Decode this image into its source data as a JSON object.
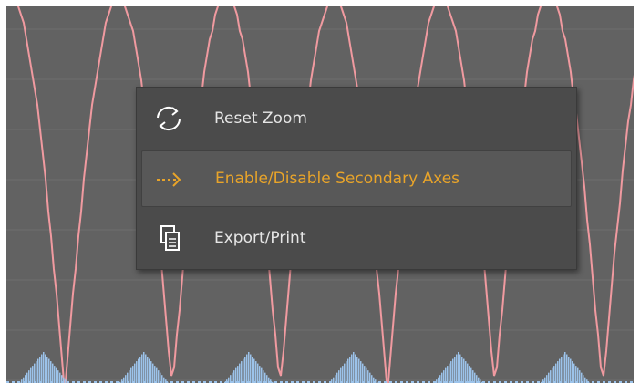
{
  "context_menu": {
    "items": [
      {
        "label": "Reset Zoom",
        "icon": "refresh-icon",
        "active": false
      },
      {
        "label": "Enable/Disable Secondary Axes",
        "icon": "dashed-arrow-right-icon",
        "active": true
      },
      {
        "label": "Export/Print",
        "icon": "export-document-icon",
        "active": false
      }
    ]
  },
  "colors": {
    "plot_background": "#626262",
    "grid_line": "#6f6f6f",
    "primary_series": "#f09aa0",
    "secondary_series": "#9cc3ea",
    "menu_background": "#4b4b4b",
    "menu_text": "#e6e6e6",
    "menu_active_text": "#e8a42a",
    "menu_active_background": "#585858"
  }
}
